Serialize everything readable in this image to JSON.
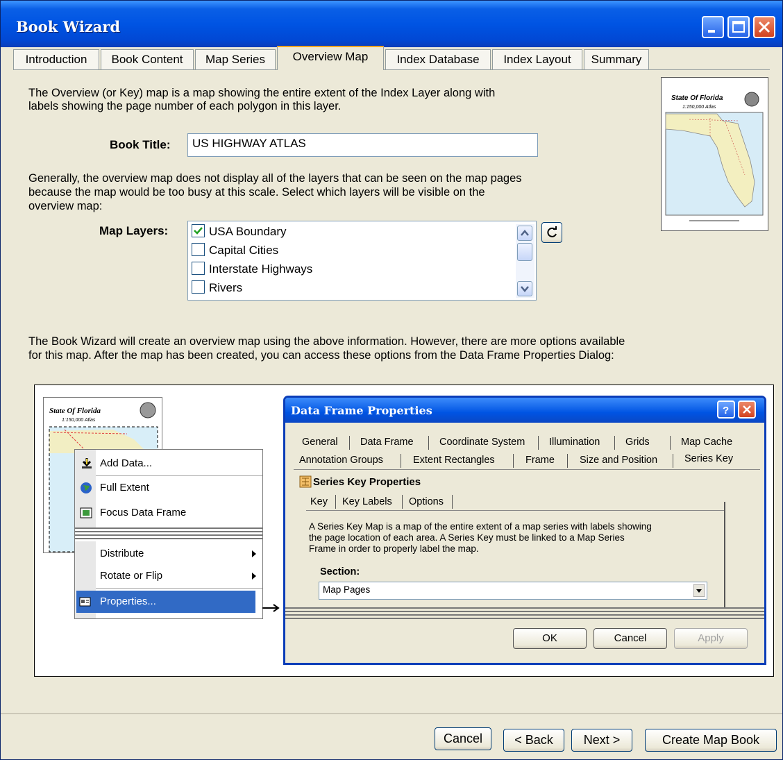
{
  "window": {
    "title": "Book Wizard"
  },
  "tabs": [
    "Introduction",
    "Book Content",
    "Map Series",
    "Overview Map",
    "Index Database",
    "Index Layout",
    "Summary"
  ],
  "active_tab": "Overview Map",
  "intro": {
    "line1": "The Overview (or Key) map is a map showing the entire extent of the Index Layer along with",
    "line2": "labels showing the page number of each polygon in this layer."
  },
  "book_title": {
    "label": "Book Title:",
    "value": "US HIGHWAY ATLAS"
  },
  "layers_text": {
    "line1": "Generally, the overview map does not display all of the layers that can be seen on the map pages",
    "line2": "because the map would be too busy at this scale.  Select which layers will be visible on the",
    "line3": "overview map:"
  },
  "map_layers": {
    "label": "Map Layers:",
    "items": [
      {
        "label": "USA Boundary",
        "checked": true
      },
      {
        "label": "Capital Cities",
        "checked": false
      },
      {
        "label": "Interstate Highways",
        "checked": false
      },
      {
        "label": "Rivers",
        "checked": false
      }
    ]
  },
  "thumbnail": {
    "title": "State Of Florida",
    "subtitle": "1:150,000 Atlas"
  },
  "info": {
    "line1": "The Book Wizard will create an overview map using the above information.  However, there are more options available",
    "line2": "for this map.  After the map has been created, you can access these options from the Data Frame Properties Dialog:"
  },
  "illustration": {
    "mini_map": {
      "title": "State Of Florida",
      "subtitle": "1:150,000 Atlas"
    },
    "context_menu": [
      "Add Data...",
      "Full Extent",
      "Focus Data Frame",
      "Distribute",
      "Rotate or Flip",
      "Properties..."
    ],
    "dialog": {
      "title": "Data Frame Properties",
      "tabs_row1": [
        "General",
        "Data Frame",
        "Coordinate System",
        "Illumination",
        "Grids",
        "Map Cache"
      ],
      "tabs_row2": [
        "Annotation Groups",
        "Extent Rectangles",
        "Frame",
        "Size and Position",
        "Series Key"
      ],
      "section_title": "Series Key Properties",
      "subtabs": [
        "Key",
        "Key Labels",
        "Options"
      ],
      "desc1": "A Series Key Map is a map of the entire extent of a map series with labels showing",
      "desc2": "the page location of each area.  A Series Key must be linked to a Map Series",
      "desc3": "Frame in order to properly label the map.",
      "section_label": "Section:",
      "section_value": "Map Pages",
      "buttons": [
        "OK",
        "Cancel",
        "Apply"
      ]
    }
  },
  "buttons": {
    "cancel": "Cancel",
    "back": "< Back",
    "next": "Next >",
    "create": "Create Map Book"
  },
  "colors": {
    "titlebar": "#0054e3",
    "face": "#ece9d8",
    "menu_highlight": "#316ac5",
    "active_tab_accent": "#f5a623"
  }
}
